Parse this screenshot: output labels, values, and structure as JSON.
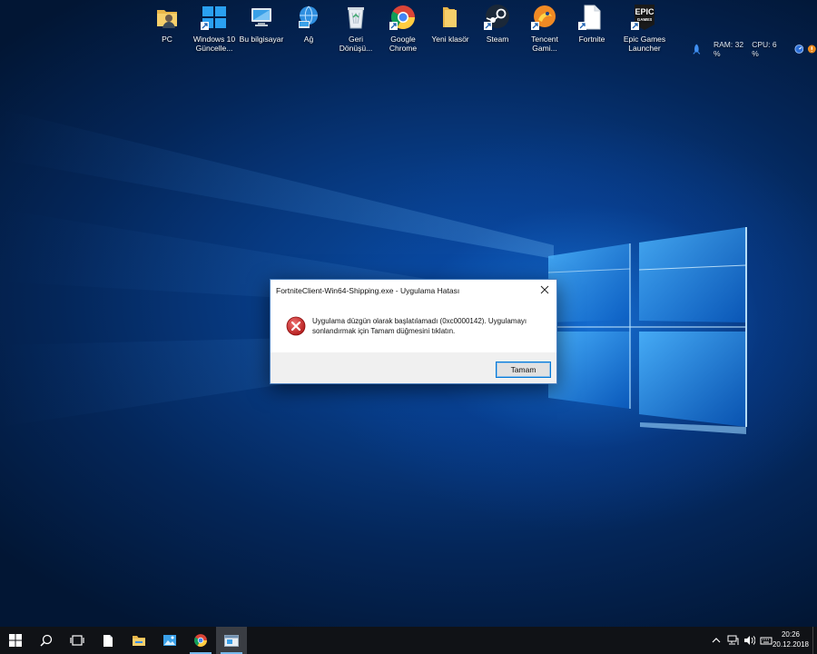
{
  "desktop": {
    "icons": [
      {
        "id": "pc",
        "label": "PC",
        "icon": "user-folder-icon",
        "shortcut": false
      },
      {
        "id": "win10-update",
        "label": "Windows 10 Güncelle...",
        "icon": "windows-logo-icon",
        "shortcut": true
      },
      {
        "id": "this-pc",
        "label": "Bu bilgisayar",
        "icon": "computer-icon",
        "shortcut": false
      },
      {
        "id": "network",
        "label": "Ağ",
        "icon": "network-icon",
        "shortcut": false
      },
      {
        "id": "recycle-bin",
        "label": "Geri Dönüşü...",
        "icon": "recycle-bin-icon",
        "shortcut": false
      },
      {
        "id": "chrome",
        "label": "Google Chrome",
        "icon": "chrome-icon",
        "shortcut": true
      },
      {
        "id": "new-folder",
        "label": "Yeni klasör",
        "icon": "folder-icon",
        "shortcut": false
      },
      {
        "id": "steam",
        "label": "Steam",
        "icon": "steam-icon",
        "shortcut": true
      },
      {
        "id": "tencent",
        "label": "Tencent Gami...",
        "icon": "tencent-icon",
        "shortcut": true
      },
      {
        "id": "fortnite",
        "label": "Fortnite",
        "icon": "blank-file-icon",
        "shortcut": true
      },
      {
        "id": "epic",
        "label": "Epic Games Launcher",
        "icon": "epic-games-icon",
        "shortcut": true
      }
    ]
  },
  "sysmon": {
    "ram": "RAM: 32 %",
    "cpu": "CPU: 6 %"
  },
  "dialog": {
    "title": "FortniteClient-Win64-Shipping.exe - Uygulama Hatası",
    "message": "Uygulama düzgün olarak başlatılamadı (0xc0000142). Uygulamayı sonlandırmak için Tamam düğmesini tıklatın.",
    "ok_label": "Tamam"
  },
  "taskbar": {
    "items": [
      "start-icon",
      "search-icon",
      "task-view-icon",
      "file-icon",
      "file-explorer-icon",
      "photos-icon",
      "chrome-icon",
      "app-window-icon"
    ],
    "clock": {
      "time": "20:26",
      "date": "20.12.2018"
    }
  },
  "colors": {
    "accent": "#0078d7",
    "error": "#d32f2f",
    "taskbar": "#101216"
  }
}
